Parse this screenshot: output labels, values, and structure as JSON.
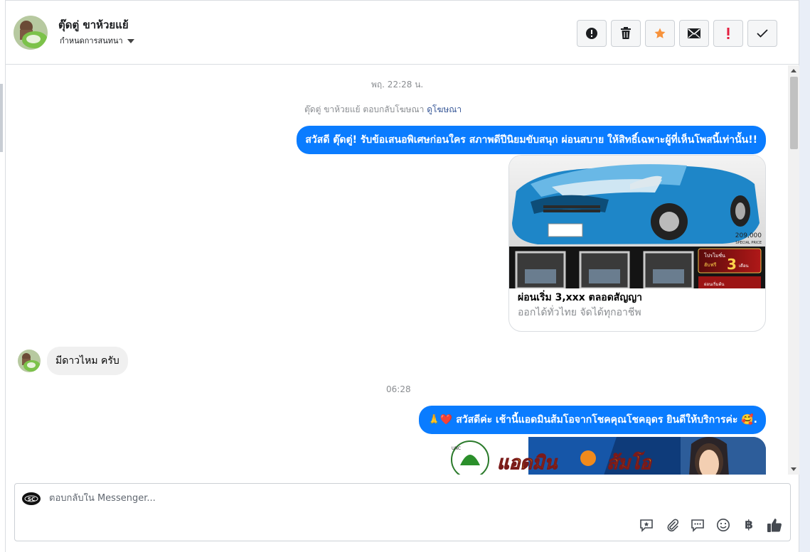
{
  "header": {
    "contact_name": "ตุ๊ดตู่ ขาห้วยแย้",
    "assign_label": "กำหนดการสนทนา",
    "actions": [
      {
        "name": "mark-spam-button",
        "icon": "alert-circle-icon"
      },
      {
        "name": "delete-button",
        "icon": "trash-icon"
      },
      {
        "name": "star-button",
        "icon": "star-icon"
      },
      {
        "name": "mark-unread-button",
        "icon": "envelope-icon"
      },
      {
        "name": "follow-up-button",
        "icon": "exclamation-icon"
      },
      {
        "name": "mark-done-button",
        "icon": "checkmark-icon"
      }
    ]
  },
  "conversation": {
    "timestamp_1": "พฤ. 22:28 น.",
    "system_note": "ตุ๊ดตู่ ขาห้วยแย้ ตอบกลับโฆษณา",
    "system_note_link": "ดูโฆษณา",
    "outgoing_1": "สวัสดี ตุ๊ดตู่! รับข้อเสนอพิเศษก่อนใคร สภาพดีปีนิยมขับสนุก ผ่อนสบาย ให้สิทธิ์เฉพาะผู้ที่เห็นโพสนี้เท่านั้น!!",
    "ad_card": {
      "image_price": "209,000",
      "image_price_caption": "SPECIAL PRICE",
      "image_promo_top": "โปรโมชั่น",
      "image_promo_free": "ฮับฟรี",
      "image_promo_number": "3",
      "image_promo_unit": "เดือน",
      "image_promo_bottom": "ผ่อนเริ่มต้น",
      "title": "ผ่อนเริ่ม 3,xxx ตลอดสัญญา",
      "subtitle": "ออกได้ทั่วไทย จัดได้ทุกอาชีพ"
    },
    "incoming_1": "มีดาวไหม ครับ",
    "timestamp_2": "06:28",
    "outgoing_2_emoji_lead": "🙏❤️",
    "outgoing_2": "สวัสดีค่ะ เช้านี้แอดมินส้มโอจากโชคคุณโชคอุดร ยินดีให้บริการค่ะ",
    "outgoing_2_emoji_tail": "🥰.",
    "promo_banner": {
      "headline_1": "แอดมิน",
      "headline_2": "ส้มโอ",
      "logo_text": "UNC"
    }
  },
  "composer": {
    "placeholder": "ตอบกลับใน Messenger...",
    "page_logo_text": "SC",
    "tools": [
      "saved-reply-icon",
      "attachment-icon",
      "quick-reply-icon",
      "emoji-icon",
      "baht-payment-icon",
      "thumbs-up-icon"
    ],
    "baht_symbol": "฿"
  },
  "colors": {
    "accent": "#0a7cff",
    "star": "#f7923b",
    "alert_red": "#e41e3f"
  }
}
